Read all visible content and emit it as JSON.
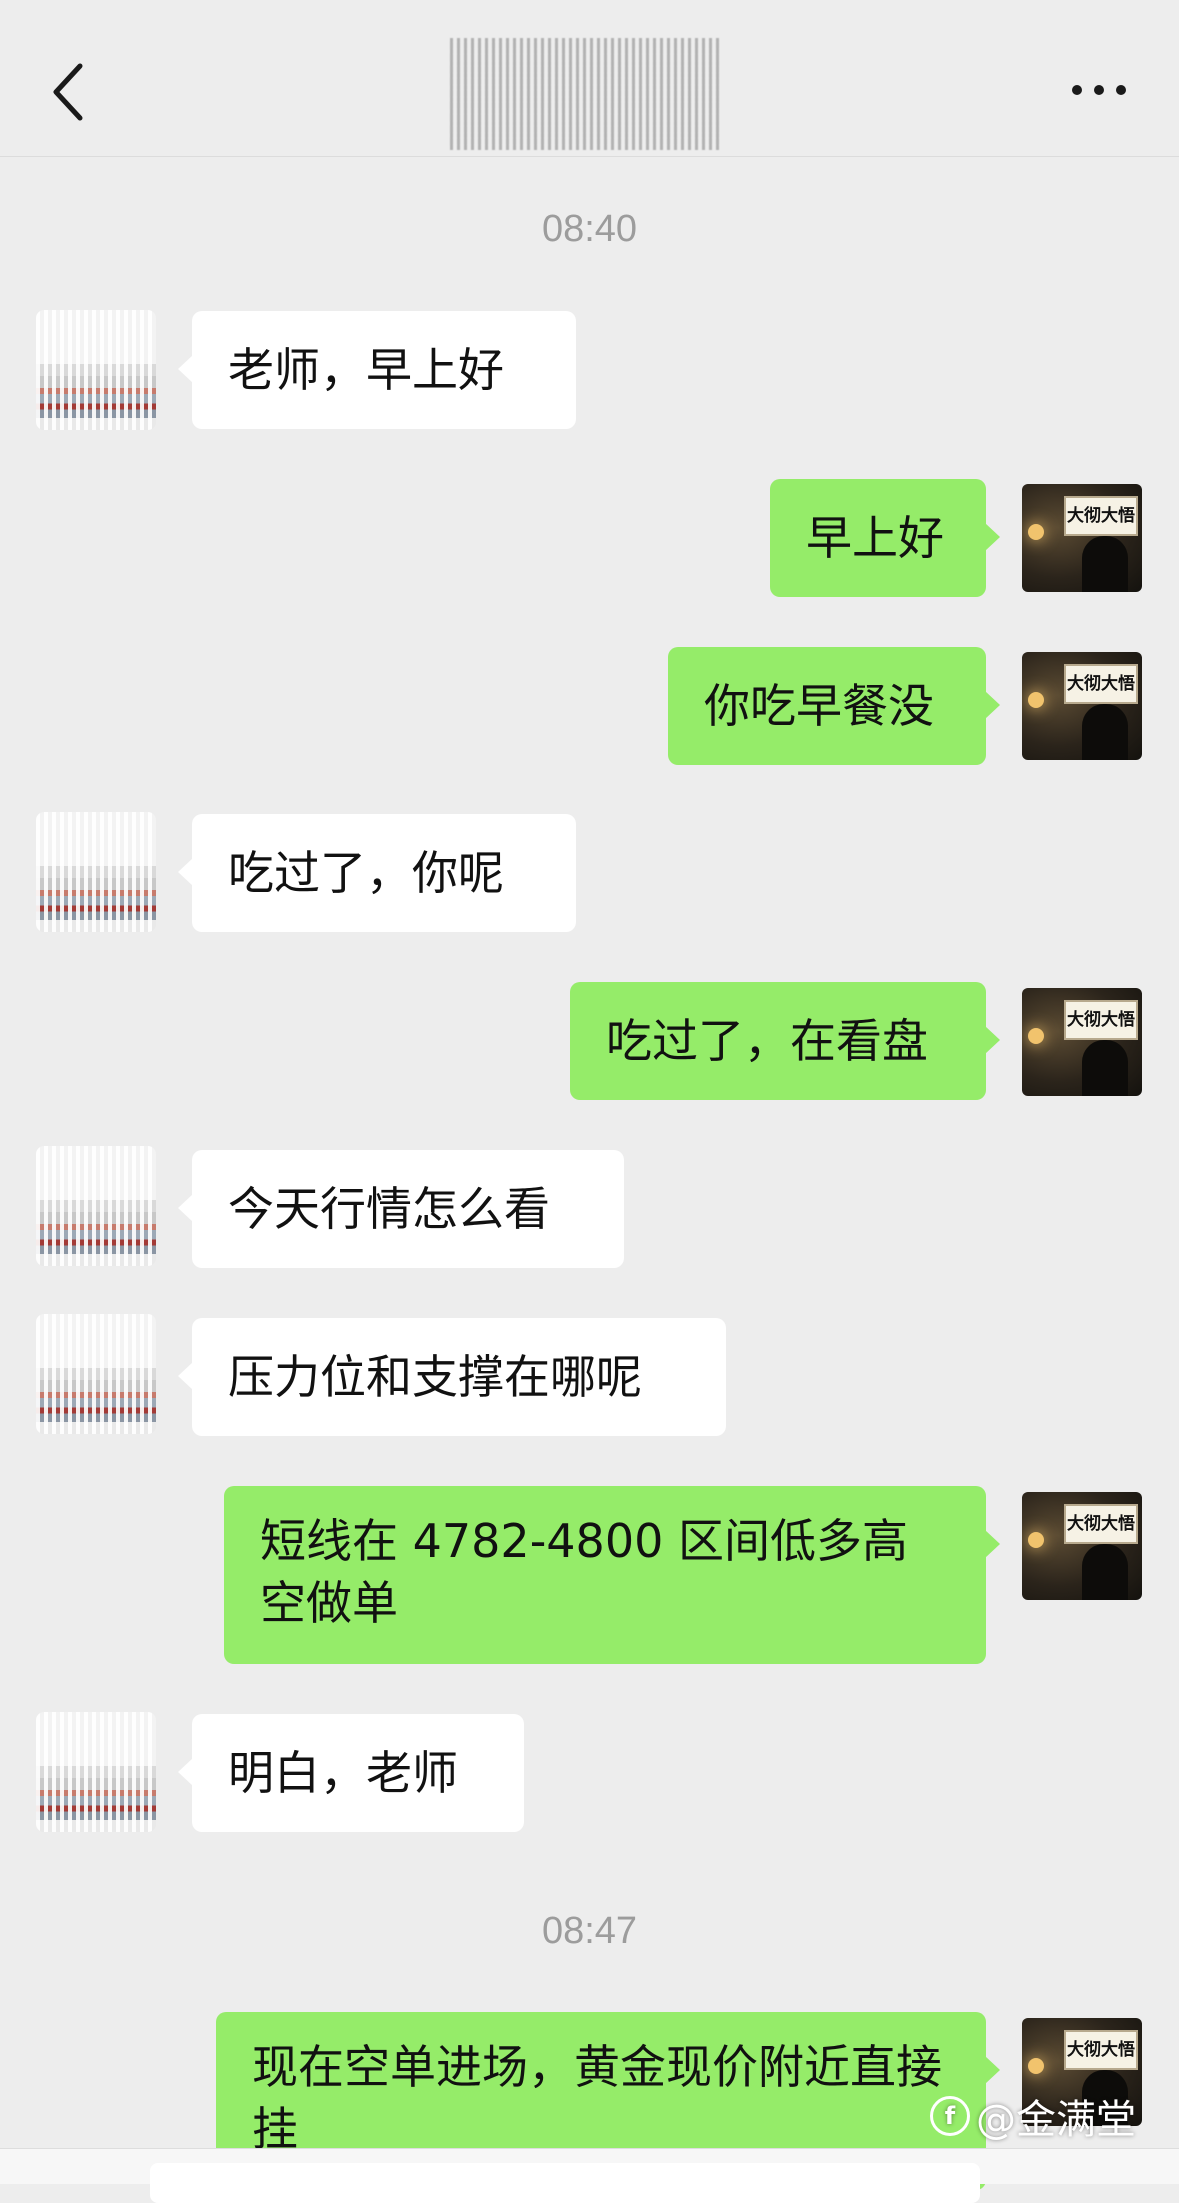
{
  "header": {
    "back_icon": "chevron-left-icon",
    "more_icon": "more-dots-icon"
  },
  "timestamps": [
    "08:40",
    "08:47"
  ],
  "messages": [
    {
      "side": "left",
      "text": "老师，早上好"
    },
    {
      "side": "right",
      "text": "早上好"
    },
    {
      "side": "right",
      "text": "你吃早餐没"
    },
    {
      "side": "left",
      "text": "吃过了，你呢"
    },
    {
      "side": "right",
      "text": "吃过了，在看盘"
    },
    {
      "side": "left",
      "text": "今天行情怎么看"
    },
    {
      "side": "left",
      "text": "压力位和支撑在哪呢"
    },
    {
      "side": "right",
      "text": "短线在 4782-4800 区间低多高空做单"
    },
    {
      "side": "left",
      "text": "明白，老师"
    },
    {
      "side": "right",
      "text": "现在空单进场，黄金现价附近直接挂"
    }
  ],
  "self_avatar": {
    "sign_text": "大彻大悟"
  },
  "watermark": {
    "logo": "f",
    "text": "@金满堂"
  },
  "colors": {
    "background": "#ededed",
    "incoming_bubble": "#ffffff",
    "outgoing_bubble": "#95ec69",
    "timestamp": "#9c9c9c"
  }
}
